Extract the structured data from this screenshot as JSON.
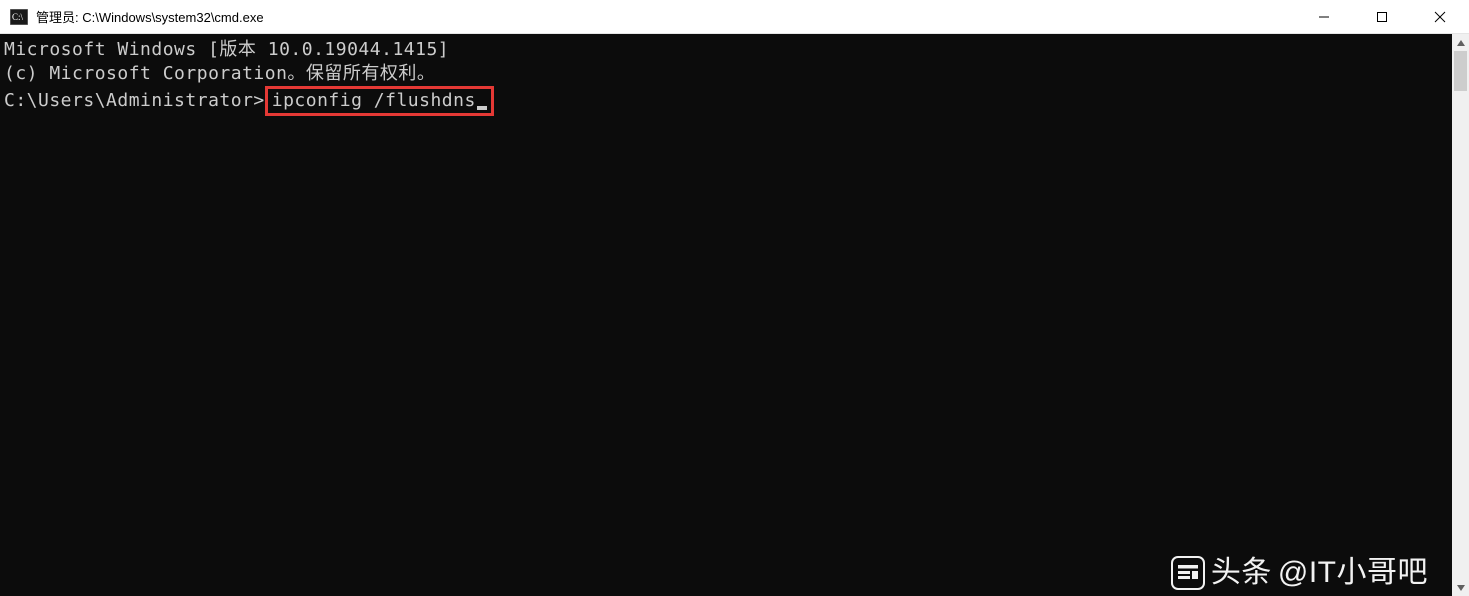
{
  "window": {
    "title": "管理员: C:\\Windows\\system32\\cmd.exe"
  },
  "terminal": {
    "line1": "Microsoft Windows [版本 10.0.19044.1415]",
    "line2": "(c) Microsoft Corporation。保留所有权利。",
    "blank": "",
    "prompt": "C:\\Users\\Administrator>",
    "command": "ipconfig /flushdns"
  },
  "watermark": {
    "prefix": "头条",
    "text": "@IT小哥吧"
  }
}
